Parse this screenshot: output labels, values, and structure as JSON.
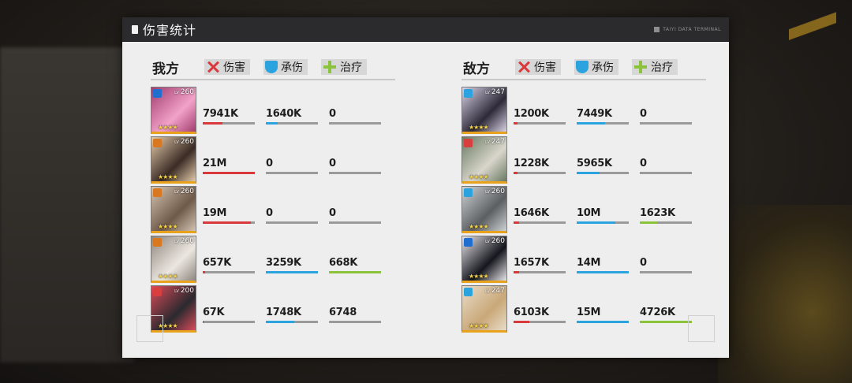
{
  "title": "伤害统计",
  "terminal_label": "TAIYI DATA TERMINAL",
  "columns": {
    "damage": "伤害",
    "taken": "承伤",
    "heal": "治疗"
  },
  "colors": {
    "damage": "#d9393b",
    "taken": "#2aa3de",
    "heal": "#8bc43a",
    "rarity": "#e8a21c"
  },
  "ally": {
    "label": "我方",
    "units": [
      {
        "level": "260",
        "stars": "★★★★",
        "art": [
          "#f2a2c9",
          "#a13d6e"
        ],
        "cls": "#1f6fd1",
        "damage": "7941K",
        "taken": "1640K",
        "heal": "0",
        "dmg_ratio": 0.38,
        "taken_ratio": 0.22,
        "heal_ratio": 0.0
      },
      {
        "level": "260",
        "stars": "★★★★",
        "art": [
          "#3a2b25",
          "#e2c9a8"
        ],
        "cls": "#d97820",
        "damage": "21M",
        "taken": "0",
        "heal": "0",
        "dmg_ratio": 1.0,
        "taken_ratio": 0.0,
        "heal_ratio": 0.0
      },
      {
        "level": "260",
        "stars": "★★★★",
        "art": [
          "#6f5a4a",
          "#d3c3b0"
        ],
        "cls": "#d97820",
        "damage": "19M",
        "taken": "0",
        "heal": "0",
        "dmg_ratio": 0.92,
        "taken_ratio": 0.0,
        "heal_ratio": 0.0
      },
      {
        "level": "260",
        "stars": "★★★★",
        "art": [
          "#ece7e0",
          "#8e877f"
        ],
        "cls": "#d97820",
        "damage": "657K",
        "taken": "3259K",
        "heal": "668K",
        "dmg_ratio": 0.04,
        "taken_ratio": 1.0,
        "heal_ratio": 1.0
      },
      {
        "level": "200",
        "stars": "★★★★",
        "art": [
          "#2a2a2e",
          "#d94a5a"
        ],
        "cls": "#d83e3e",
        "damage": "67K",
        "taken": "1748K",
        "heal": "6748",
        "dmg_ratio": 0.01,
        "taken_ratio": 0.55,
        "heal_ratio": 0.02
      }
    ]
  },
  "enemy": {
    "label": "敌方",
    "units": [
      {
        "level": "247",
        "stars": "★★★★",
        "art": [
          "#2d2a38",
          "#d9d2e6"
        ],
        "cls": "#2aa3de",
        "damage": "1200K",
        "taken": "7449K",
        "heal": "0",
        "dmg_ratio": 0.07,
        "taken_ratio": 0.55,
        "heal_ratio": 0.0
      },
      {
        "level": "247",
        "stars": "★★★★",
        "art": [
          "#d9d6cc",
          "#6a7a62"
        ],
        "cls": "#d83e3e",
        "damage": "1228K",
        "taken": "5965K",
        "heal": "0",
        "dmg_ratio": 0.08,
        "taken_ratio": 0.44,
        "heal_ratio": 0.0
      },
      {
        "level": "260",
        "stars": "★★★★",
        "art": [
          "#5c5f62",
          "#cfd2d4"
        ],
        "cls": "#2aa3de",
        "damage": "1646K",
        "taken": "10M",
        "heal": "1623K",
        "dmg_ratio": 0.1,
        "taken_ratio": 0.74,
        "heal_ratio": 0.34
      },
      {
        "level": "260",
        "stars": "★★★★",
        "art": [
          "#15151d",
          "#e6e6ea"
        ],
        "cls": "#1f6fd1",
        "damage": "1657K",
        "taken": "14M",
        "heal": "0",
        "dmg_ratio": 0.1,
        "taken_ratio": 1.0,
        "heal_ratio": 0.0
      },
      {
        "level": "247",
        "stars": "★★★★",
        "art": [
          "#c9a878",
          "#e9dcc9"
        ],
        "cls": "#2aa3de",
        "damage": "6103K",
        "taken": "15M",
        "heal": "4726K",
        "dmg_ratio": 0.3,
        "taken_ratio": 1.0,
        "heal_ratio": 1.0
      }
    ]
  }
}
